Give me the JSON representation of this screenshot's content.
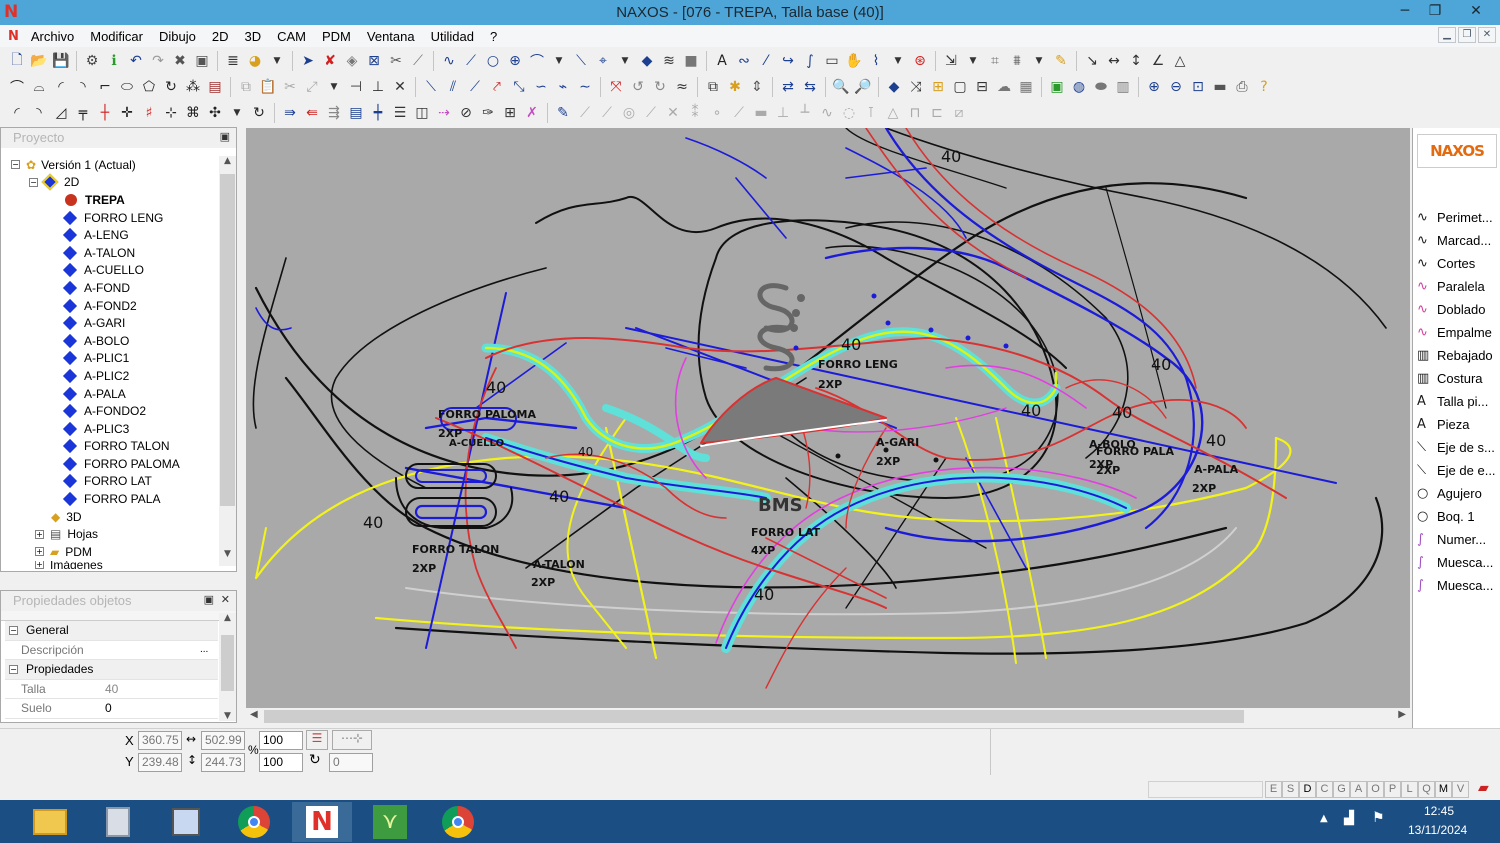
{
  "window": {
    "title": "NAXOS - [076 - TREPA, Talla base (40)]",
    "app_logo": "N",
    "min_label": "─",
    "max_label": "❐",
    "close_label": "✕"
  },
  "menu": {
    "items": [
      "Archivo",
      "Modificar",
      "Dibujo",
      "2D",
      "3D",
      "CAM",
      "PDM",
      "Ventana",
      "Utilidad",
      "?"
    ]
  },
  "toolbar": {
    "row1": [
      "new-icon",
      "open-icon",
      "save-icon",
      "settings-icon",
      "info-icon",
      "undo-icon",
      "redo-icon",
      "delete-icon",
      "select-icon",
      "layers-icon",
      "color-icon",
      "move-icon",
      "erase-icon",
      "point-icon",
      "frame-icon",
      "curve-icon",
      "line-icon",
      "circle-icon",
      "cross-icon",
      "arc-icon",
      "text-icon",
      "wave-icon"
    ],
    "row2": [
      "arc-tool-icon",
      "angle-icon",
      "corner-icon",
      "rect-icon",
      "ellipse-icon",
      "copy-icon",
      "paste-icon",
      "cut-icon",
      "mirror-icon",
      "scale-icon",
      "zoom-in-icon",
      "zoom-out-icon",
      "zoom-fit-icon",
      "print-icon",
      "help-icon"
    ],
    "row3": [
      "split-icon",
      "join-icon",
      "trim-icon",
      "extend-icon",
      "rotate-icon",
      "pattern-icon",
      "grade-icon",
      "measure-icon",
      "snap-icon"
    ]
  },
  "project_panel": {
    "title": "Proyecto",
    "root": "Versión 1 (Actual)",
    "folder_2d": "2D",
    "pieces": [
      "TREPA",
      "FORRO LENG",
      "A-LENG",
      "A-TALON",
      "A-CUELLO",
      "A-FOND",
      "A-FOND2",
      "A-GARI",
      "A-BOLO",
      "A-PLIC1",
      "A-PLIC2",
      "A-PALA",
      "A-FONDO2",
      "A-PLIC3",
      "FORRO TALON",
      "FORRO PALOMA",
      "FORRO LAT",
      "FORRO PALA"
    ],
    "folder_3d": "3D",
    "folder_hojas": "Hojas",
    "folder_pdm": "PDM",
    "folder_img": "Imágenes"
  },
  "props_panel": {
    "title": "Propiedades objetos",
    "group_general": "General",
    "desc_label": "Descripción",
    "desc_value": "",
    "desc_btn": "...",
    "group_props": "Propiedades",
    "talla_label": "Talla",
    "talla_value": "40",
    "suelo_label": "Suelo",
    "suelo_value": "0"
  },
  "canvas": {
    "labels": {
      "t40a": "40",
      "t40b": "40",
      "t40c": "40",
      "t40d": "40",
      "t40e": "40",
      "t40f": "40",
      "t40g": "40",
      "t40h": "40",
      "t40i": "40",
      "t40j": "40",
      "t40k": "40",
      "forro_paloma": "FORRO PALOMA",
      "forro_paloma_qty": "2XP",
      "a_cuello": "A-CUELLO",
      "forro_talon": "FORRO TALON",
      "forro_talon_qty": "2XP",
      "a_talon": "A-TALON",
      "a_talon_qty": "2XP",
      "forro_leng": "FORRO LENG",
      "forro_leng_qty": "2XP",
      "a_gari": "A-GARI",
      "a_gari_qty": "2XP",
      "forro_lat": "FORRO LAT",
      "forro_lat_qty": "4XP",
      "bms": "BMS",
      "a_bolo": "A-BOLO",
      "a_bolo_qty": "2XP",
      "forro_pala": "FORRO PALA",
      "forro_pala_qty": "2XP",
      "a_pala": "A-PALA",
      "a_pala_qty": "2XP"
    },
    "colors": {
      "bg": "#a9a9a9",
      "black": "#111111",
      "blue": "#1c1cd8",
      "red": "#d83232",
      "yellow": "#f3f31a",
      "cyan": "#5fe0d8",
      "magenta": "#e040e0",
      "gray": "#d0d0d0"
    }
  },
  "right_panel": {
    "logo": "NAXOS",
    "items": [
      "Perimet...",
      "Marcad...",
      "Cortes",
      "Paralela",
      "Doblado",
      "Empalme",
      "Rebajado",
      "Costura",
      "Talla pi...",
      "Pieza",
      "Eje de s...",
      "Eje de e...",
      "Agujero",
      "Boq. 1",
      "Numer...",
      "Muesca...",
      "Muesca..."
    ]
  },
  "coords": {
    "x_label": "X",
    "y_label": "Y",
    "x": "360.75",
    "y": "239.48",
    "w": "502.99",
    "h": "244.73",
    "sx": "100",
    "sy": "100",
    "pct": "%",
    "rot": "0"
  },
  "status": {
    "keys": [
      "E",
      "S",
      "D",
      "C",
      "G",
      "A",
      "O",
      "P",
      "L",
      "Q",
      "M",
      "V"
    ]
  },
  "taskbar": {
    "time": "12:45",
    "date": "13/11/2024",
    "apps": [
      "file-explorer-icon",
      "calculator-icon",
      "documents-icon",
      "chrome-icon",
      "naxos-icon",
      "leaf-app-icon",
      "chrome-profile-icon"
    ]
  }
}
